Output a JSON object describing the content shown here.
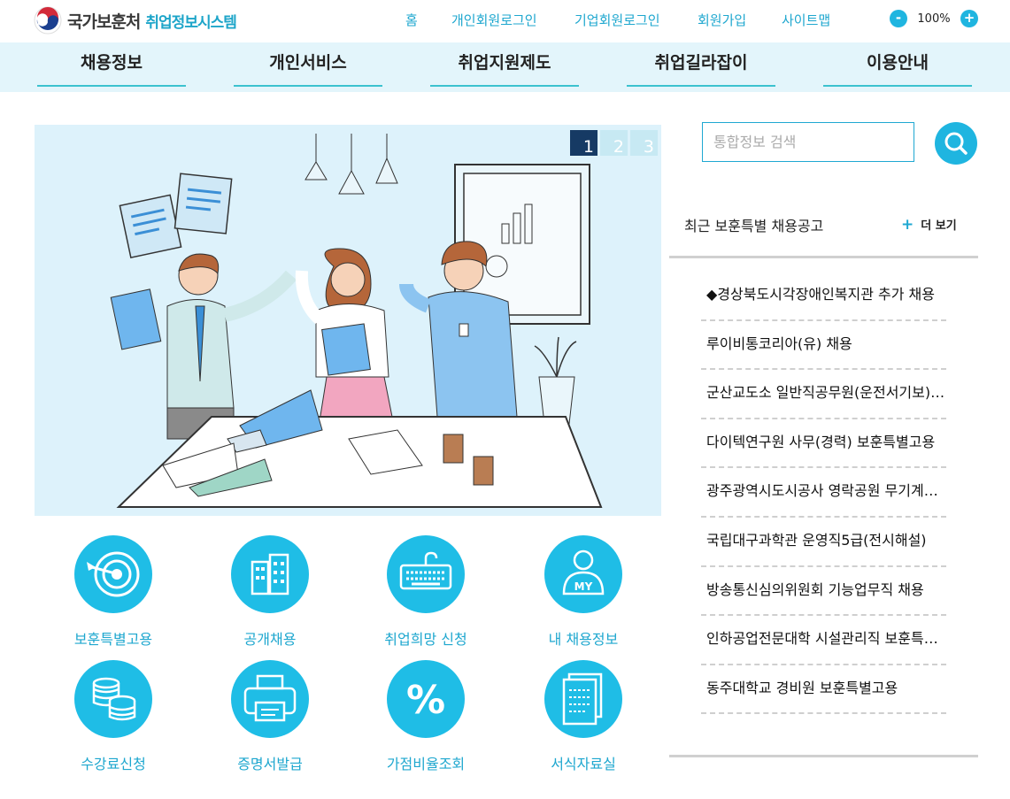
{
  "header": {
    "logo_org": "국가보훈처",
    "logo_system": "취업정보시스템",
    "util_links": [
      "홈",
      "개인회원로그인",
      "기업회원로그인",
      "회원가입",
      "사이트맵"
    ],
    "zoom": {
      "minus": "-",
      "value": "100%",
      "plus": "+"
    }
  },
  "nav": {
    "items": [
      "채용정보",
      "개인서비스",
      "취업지원제도",
      "취업길라잡이",
      "이용안내"
    ]
  },
  "banner": {
    "pages": [
      "1",
      "2",
      "3"
    ],
    "active_page": 1
  },
  "quick_menu": [
    {
      "label": "보훈특별고용",
      "icon": "target-icon"
    },
    {
      "label": "공개채용",
      "icon": "buildings-icon"
    },
    {
      "label": "취업희망 신청",
      "icon": "keyboard-icon"
    },
    {
      "label": "내 채용정보",
      "icon": "my-user-icon",
      "badge": "MY"
    },
    {
      "label": "수강료신청",
      "icon": "coins-icon"
    },
    {
      "label": "증명서발급",
      "icon": "printer-icon"
    },
    {
      "label": "가점비율조회",
      "icon": "percent-icon",
      "glyph": "%"
    },
    {
      "label": "서식자료실",
      "icon": "document-icon"
    }
  ],
  "search": {
    "placeholder": "통합정보 검색"
  },
  "jobs": {
    "title": "최근 보훈특별 채용공고",
    "more_label": "더 보기",
    "more_plus": "+",
    "items": [
      "◆경상북도시각장애인복지관 추가 채용",
      "루이비통코리아(유) 채용",
      "군산교도소 일반직공무원(운전서기보) 채용",
      "다이텍연구원 사무(경력) 보훈특별고용",
      "광주광역시도시공사 영락공원 무기계약직",
      "국립대구과학관 운영직5급(전시해설)",
      "방송통신심의위원회 기능업무직 채용",
      "인하공업전문대학 시설관리직 보훈특별고용",
      "동주대학교 경비원 보훈특별고용"
    ]
  },
  "colors": {
    "accent": "#1fb5e0",
    "nav_bg": "#e3f5fb",
    "banner_bg": "#ddf2fb"
  }
}
